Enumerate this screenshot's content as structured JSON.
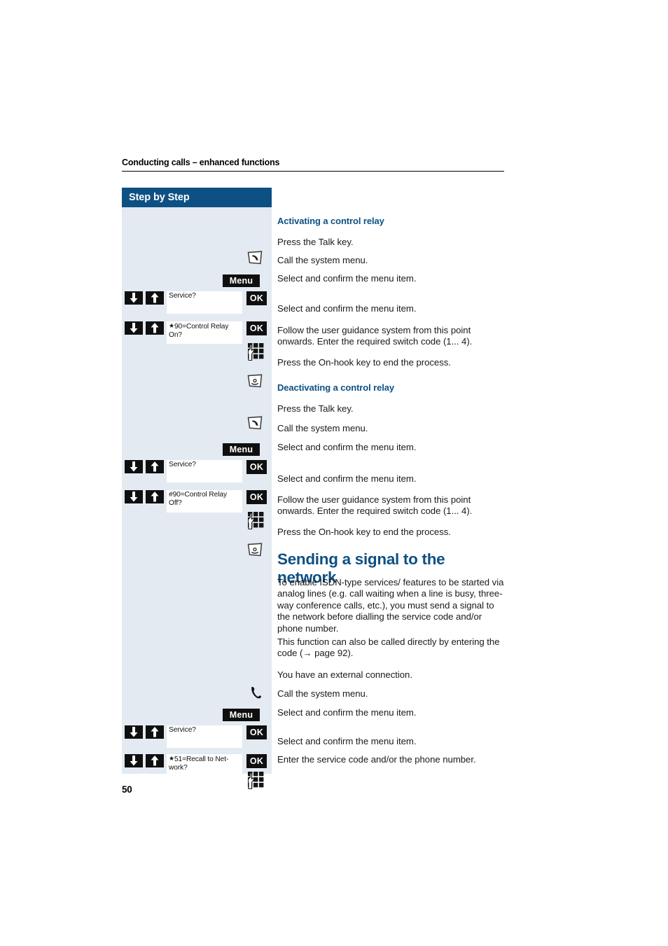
{
  "header": {
    "running_head": "Conducting calls – enhanced functions"
  },
  "sidebar": {
    "title": "Step by Step"
  },
  "folio": {
    "page_number": "50"
  },
  "sections": [
    {
      "id": "activating",
      "heading": "Activating a control relay",
      "steps": [
        {
          "icon": "talk-key-icon",
          "text": "Press the Talk key."
        },
        {
          "icon": "menu-button",
          "label": "Menu",
          "text": "Call the system menu."
        },
        {
          "icon": "ok-button",
          "label": "OK",
          "display": "Service?",
          "text": "Select and confirm the menu item."
        },
        {
          "icon": "ok-button",
          "label": "OK",
          "display": "★ 90=Control Relay On?",
          "text": "Select and confirm the menu item."
        },
        {
          "icon": "keypad-icon",
          "text": "Follow the user guidance system from this point onwards. Enter the required switch code (1... 4)."
        },
        {
          "icon": "on-hook-key-icon",
          "text": "Press the On-hook key to end the process."
        }
      ]
    },
    {
      "id": "deactivating",
      "heading": "Deactivating a control relay",
      "steps": [
        {
          "icon": "talk-key-icon",
          "text": "Press the Talk key."
        },
        {
          "icon": "menu-button",
          "label": "Menu",
          "text": "Call the system menu."
        },
        {
          "icon": "ok-button",
          "label": "OK",
          "display": "Service?",
          "text": "Select and confirm the menu item."
        },
        {
          "icon": "ok-button",
          "label": "OK",
          "display": "#90=Control Relay Off?",
          "text": "Select and confirm the menu item."
        },
        {
          "icon": "keypad-icon",
          "text": "Follow the user guidance system from this point onwards. Enter the required switch code (1... 4)."
        },
        {
          "icon": "on-hook-key-icon",
          "text": "Press the On-hook key to end the process."
        }
      ]
    },
    {
      "id": "sending-signal",
      "heading": "Sending a signal to the network",
      "paragraphs": [
        "To enable ISDN-type services/ features to be started via analog lines (e.g. call waiting when a line is busy, three-way conference calls, etc.), you must send a signal to the network before dialling the service code and/or phone number.",
        "This function can also be called directly by entering the code (→ page 92)."
      ],
      "steps": [
        {
          "icon": "handset-icon",
          "text": "You have an external connection."
        },
        {
          "icon": "menu-button",
          "label": "Menu",
          "text": "Call the system menu."
        },
        {
          "icon": "ok-button",
          "label": "OK",
          "display": "Service?",
          "text": "Select and confirm the menu item."
        },
        {
          "icon": "ok-button",
          "label": "OK",
          "display": "★ 51=Recall to Network?",
          "text": "Select and confirm the menu item."
        },
        {
          "icon": "keypad-icon",
          "text": "Enter the service code and/or the phone number."
        }
      ]
    }
  ],
  "labels": {
    "menu": "Menu",
    "ok": "OK",
    "display_service": "Service?",
    "display_relay_on_line1": "90=Control Relay",
    "display_relay_on_line2": "On?",
    "display_relay_off_line1": "#90=Control Relay",
    "display_relay_off_line2": "Off?",
    "display_recall_line1": "51=Recall to Net-",
    "display_recall_line2": "work?"
  },
  "text": {
    "h_activating": "Activating a control relay",
    "h_deactivating": "Deactivating a control relay",
    "h_sending": "Sending a signal to the network",
    "t_press_talk": "Press the Talk key.",
    "t_call_menu": "Call the system menu.",
    "t_select_confirm": "Select and confirm the menu item.",
    "t_follow_guidance": "Follow the user guidance system from this point onwards. Enter the required switch code (1... 4).",
    "t_press_onhook": "Press the On-hook key to end the process.",
    "t_external_conn": "You have an external connection.",
    "t_enter_service_code": "Enter the service code and/or the phone number.",
    "p_isdn": "To enable ISDN-type services/ features to be started via analog lines (e.g. call waiting when a line is busy, three-way conference calls, etc.), you must send a signal to the network before dialling the service code and/or phone number.",
    "p_direct": "This function can also be called directly by entering the code (→ page 92)."
  },
  "colors": {
    "brand_blue": "#0d5084",
    "sidebar_fill": "#e3eaf1",
    "key_black": "#0f0f0f"
  }
}
